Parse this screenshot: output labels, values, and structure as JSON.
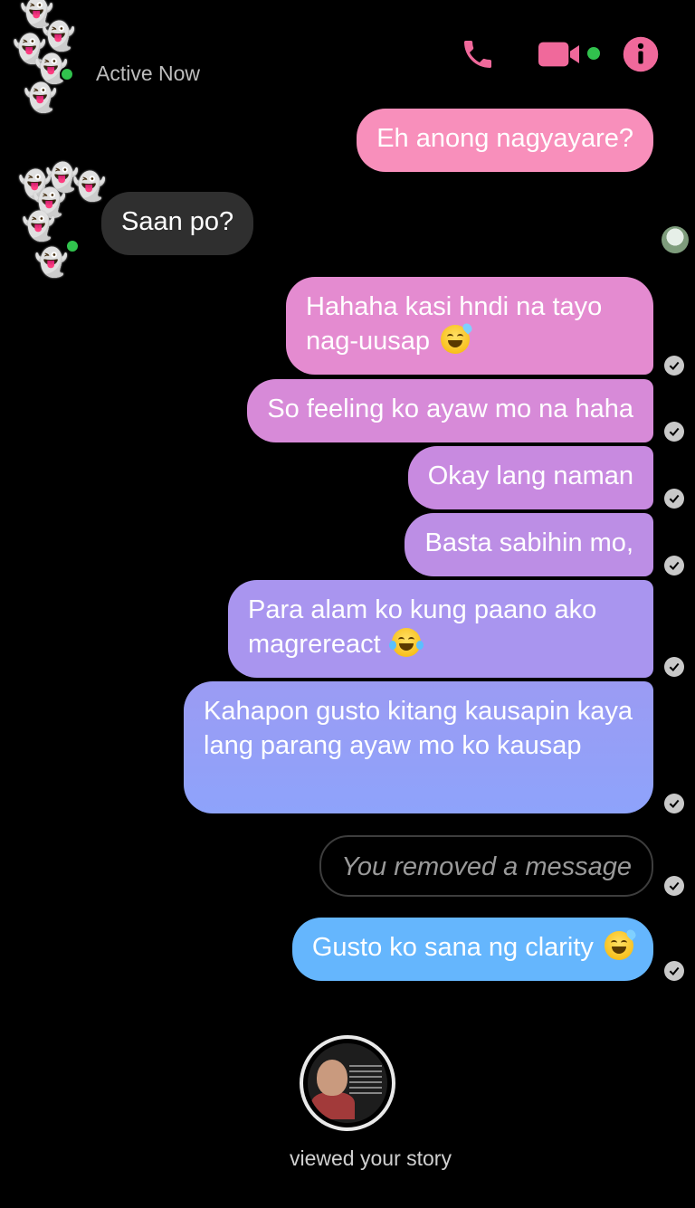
{
  "header": {
    "status": "Active Now",
    "icons": {
      "call": "phone-icon",
      "video": "video-camera-icon",
      "info": "info-icon"
    },
    "colors": {
      "accent": "#f0699b",
      "online": "#31c24d"
    }
  },
  "messages": [
    {
      "from": "me",
      "text": "Eh anong nagyayare?"
    },
    {
      "from": "them",
      "text": "Saan po?"
    },
    {
      "from": "me",
      "text": "Hahaha kasi hndi na tayo nag-uusap",
      "emoji": "grinning-sweat"
    },
    {
      "from": "me",
      "text": "So feeling ko ayaw mo na haha"
    },
    {
      "from": "me",
      "text": "Okay lang naman"
    },
    {
      "from": "me",
      "text": "Basta sabihin mo,"
    },
    {
      "from": "me",
      "text": "Para alam ko kung paano ako magrereact",
      "emoji": "tears-of-joy"
    },
    {
      "from": "me",
      "text": "Kahapon gusto kitang kausapin kaya lang parang ayaw mo ko kausap"
    },
    {
      "from": "me",
      "text": "You removed a message",
      "removed": true
    },
    {
      "from": "me",
      "text": "Gusto ko sana ng clarity",
      "emoji": "grinning-sweat"
    }
  ],
  "story": {
    "caption": "viewed your story"
  },
  "bubble_colors": [
    "#f88fbb",
    "#e48bd0",
    "#d78ad8",
    "#c88ae0",
    "#bc8ee5",
    "#a995ef",
    "#8ea3fb",
    "#65b6fd"
  ]
}
